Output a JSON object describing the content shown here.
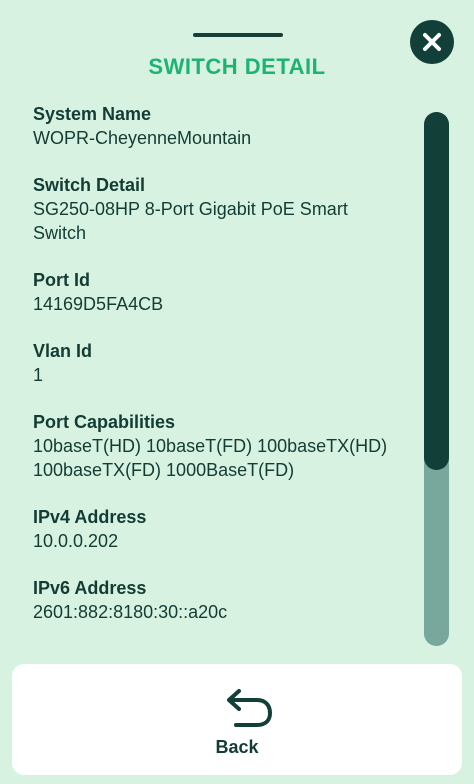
{
  "header": {
    "title": "SWITCH DETAIL"
  },
  "close": {
    "icon": "close-icon"
  },
  "details": [
    {
      "label": "System Name",
      "value": "WOPR-CheyenneMountain"
    },
    {
      "label": "Switch Detail",
      "value": "SG250-08HP 8-Port Gigabit PoE Smart Switch"
    },
    {
      "label": "Port Id",
      "value": "14169D5FA4CB"
    },
    {
      "label": "Vlan Id",
      "value": "1"
    },
    {
      "label": "Port Capabilities",
      "value": "10baseT(HD) 10baseT(FD) 100baseTX(HD) 100baseTX(FD) 1000BaseT(FD)"
    },
    {
      "label": "IPv4 Address",
      "value": "10.0.0.202"
    },
    {
      "label": "IPv6 Address",
      "value": "2601:882:8180:30::a20c"
    }
  ],
  "footer": {
    "back_label": "Back",
    "back_icon": "back-arrow-icon"
  },
  "colors": {
    "background": "#d8f2e2",
    "title": "#1db373",
    "dark": "#123f38",
    "scroll_track": "#77a89b",
    "card": "#ffffff"
  }
}
